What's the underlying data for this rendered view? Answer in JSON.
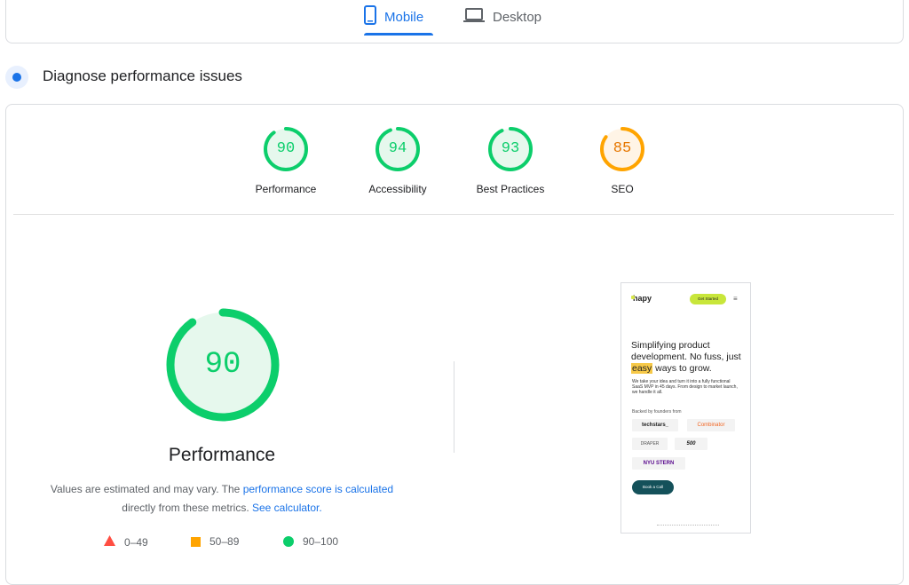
{
  "tabs": {
    "mobile": {
      "label": "Mobile",
      "icon": "smartphone-icon",
      "active": true
    },
    "desktop": {
      "label": "Desktop",
      "icon": "laptop-icon",
      "active": false
    }
  },
  "section": {
    "title": "Diagnose performance issues",
    "icon": "lighthouse-icon"
  },
  "categories": [
    {
      "label": "Performance",
      "score": "90",
      "color": "#0cce6b",
      "fill": "#e6f8ed"
    },
    {
      "label": "Accessibility",
      "score": "94",
      "color": "#0cce6b",
      "fill": "#e6f8ed"
    },
    {
      "label": "Best Practices",
      "score": "93",
      "color": "#0cce6b",
      "fill": "#e6f8ed"
    },
    {
      "label": "SEO",
      "score": "85",
      "color": "#ffa400",
      "fill": "#fff4e6"
    }
  ],
  "performance": {
    "score": "90",
    "title": "Performance",
    "disclaimer_prefix": "Values are estimated and may vary. The",
    "disclaimer_link1": "performance score is calculated",
    "disclaimer_mid": "directly from these metrics.",
    "disclaimer_link2": "See calculator."
  },
  "legend": [
    {
      "label": "0–49",
      "shape": "triangle",
      "color": "#ff4e42"
    },
    {
      "label": "50–89",
      "shape": "square",
      "color": "#ffa400"
    },
    {
      "label": "90–100",
      "shape": "circle",
      "color": "#0cce6b"
    }
  ],
  "screenshot": {
    "logo": "hapy",
    "cta": "Get Started",
    "headline_1": "Simplifying product development. No fuss, just",
    "headline_hl": "easy",
    "headline_2": "ways to grow.",
    "subtext": "We take your idea and turn it into a fully functional SaaS MVP in 45 days. From design to market launch, we handle it all.",
    "backed": "Backed by founders from",
    "logos": [
      "techstars_",
      "Combinator",
      "DRAPER",
      "500",
      "NYU STERN"
    ],
    "button": "Book a Call"
  }
}
